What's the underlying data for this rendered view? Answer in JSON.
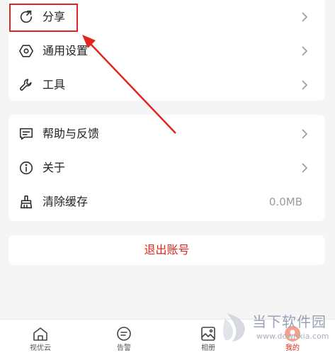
{
  "menu_group_1": [
    {
      "label": "分享",
      "icon": "share-icon"
    },
    {
      "label": "通用设置",
      "icon": "settings-hexagon-icon"
    },
    {
      "label": "工具",
      "icon": "wrench-icon"
    }
  ],
  "menu_group_2": [
    {
      "label": "帮助与反馈",
      "icon": "feedback-icon"
    },
    {
      "label": "关于",
      "icon": "info-icon"
    },
    {
      "label": "清除缓存",
      "icon": "broom-icon",
      "value": "0.0MB"
    }
  ],
  "logout_label": "退出账号",
  "tabbar": [
    {
      "label": "视优云",
      "icon": "home-icon"
    },
    {
      "label": "告警",
      "icon": "alert-message-icon"
    },
    {
      "label": "相册",
      "icon": "album-icon"
    },
    {
      "label": "我的",
      "icon": "profile-icon",
      "active": true
    }
  ],
  "watermark": {
    "text": "当下软件园",
    "sub": "www.downxia.com"
  },
  "colors": {
    "accent": "#e0251c",
    "highlight": "#e0261f",
    "background": "#f5f5f5"
  }
}
